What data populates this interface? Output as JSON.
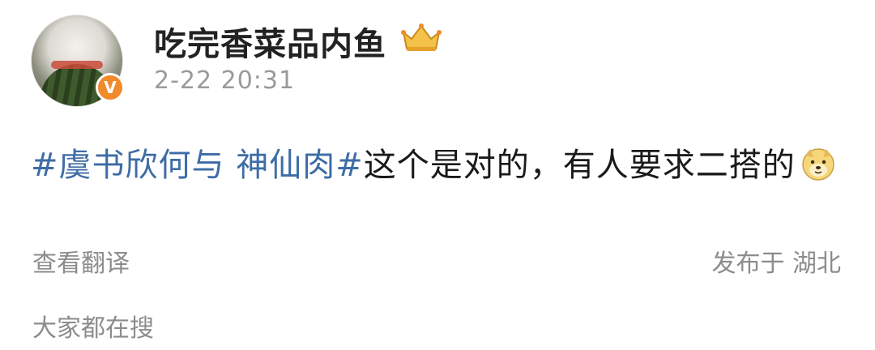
{
  "post": {
    "username": "吃完香菜品内鱼",
    "timestamp": "2-22 20:31",
    "hashtag": "#虞书欣何与 神仙肉#",
    "text": "这个是对的，有人要求二搭的",
    "emoji": "doge-emoji",
    "badge": "V",
    "crown_icon": "crown-badge-icon"
  },
  "footer": {
    "translate_label": "查看翻译",
    "location_label": "发布于 湖北",
    "trending_label": "大家都在搜"
  },
  "colors": {
    "hashtag": "#3e6ca6",
    "verified": "#f08a2b",
    "muted": "#8c8c8c"
  }
}
